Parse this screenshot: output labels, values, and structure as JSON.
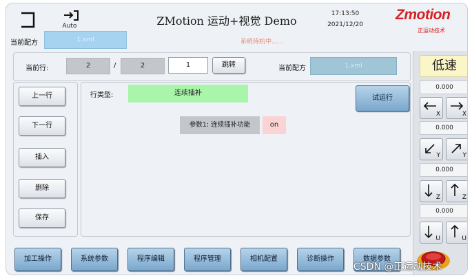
{
  "header": {
    "title": "ZMotion 运动+视觉 Demo",
    "time": "17:13:50",
    "date": "2021/12/20",
    "auto_label": "Auto",
    "logo_text": "Zmotion",
    "logo_sub": "正运动技术"
  },
  "recipe_bar": {
    "label": "当前配方",
    "value": "1.xml",
    "status": "系统待机中......"
  },
  "line_bar": {
    "current_line_label": "当前行:",
    "current_line_value": "2",
    "separator": "/",
    "total_lines_value": "2",
    "jump_input_value": "1",
    "jump_button": "跳转",
    "recipe_label": "当前配方",
    "recipe_value": "1.xml"
  },
  "left_buttons": [
    "上一行",
    "下一行",
    "插入",
    "删除",
    "保存"
  ],
  "editor": {
    "row_type_label": "行类型:",
    "row_type_value": "连续插补",
    "param_label": "参数1: 连续插补功能",
    "param_value": "on",
    "test_run_button": "试运行"
  },
  "sidebar": {
    "speed_label": "低速",
    "readouts": [
      "0.000",
      "0.000",
      "0.000",
      "0.000"
    ],
    "axes": [
      {
        "name": "X",
        "minus_icon": "arrow-left-icon",
        "plus_icon": "arrow-right-icon"
      },
      {
        "name": "Y",
        "minus_icon": "arrow-down-left-icon",
        "plus_icon": "arrow-up-right-icon"
      },
      {
        "name": "Z",
        "minus_icon": "arrow-down-icon",
        "plus_icon": "arrow-up-icon"
      },
      {
        "name": "U",
        "minus_icon": "arrow-down-icon",
        "plus_icon": "arrow-up-icon"
      }
    ]
  },
  "bottom_tabs": [
    "加工操作",
    "系统参数",
    "程序编辑",
    "程序管理",
    "相机配置",
    "诊断操作",
    "数据参数"
  ],
  "watermark": "CSDN @正运动技术",
  "colors": {
    "logo_red": "#d42020",
    "row_type_green": "#a9f5a9",
    "on_pink": "#fbd3d5",
    "speed_yellow": "#fbf6c8",
    "tab_blue": "#7aa7cc"
  }
}
